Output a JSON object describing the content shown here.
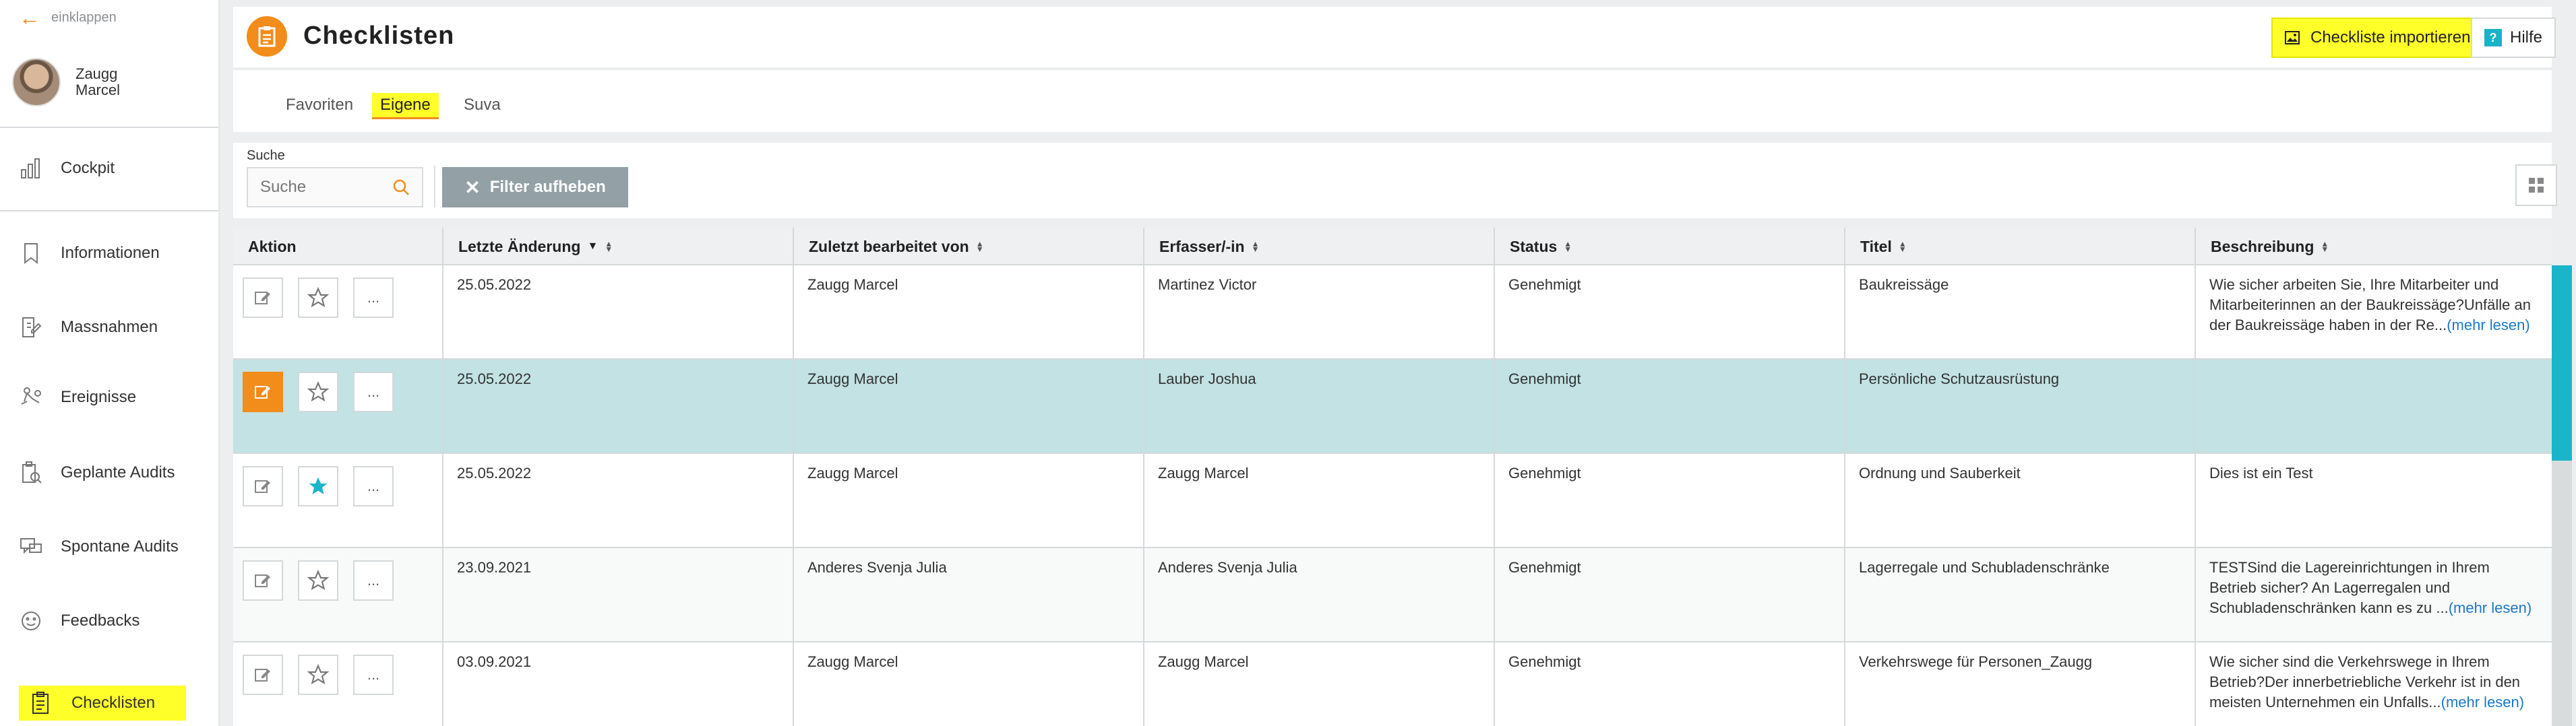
{
  "sidebar": {
    "collapse_label": "einklappen",
    "user": {
      "first": "Zaugg",
      "last": "Marcel"
    },
    "items": [
      {
        "label": "Cockpit",
        "icon": "chart-icon"
      },
      {
        "label": "Informationen",
        "icon": "bookmark-icon"
      },
      {
        "label": "Massnahmen",
        "icon": "edit-doc-icon"
      },
      {
        "label": "Ereignisse",
        "icon": "injury-icon"
      },
      {
        "label": "Geplante Audits",
        "icon": "clipboard-search-icon"
      },
      {
        "label": "Spontane Audits",
        "icon": "chat-icon"
      },
      {
        "label": "Feedbacks",
        "icon": "face-icon"
      },
      {
        "label": "Checklisten",
        "icon": "clipboard-icon"
      }
    ]
  },
  "header": {
    "title": "Checklisten",
    "import_label": "Checkliste importieren",
    "help_label": "Hilfe"
  },
  "tabs": [
    {
      "label": "Favoriten"
    },
    {
      "label": "Eigene",
      "active": true
    },
    {
      "label": "Suva"
    }
  ],
  "filters": {
    "search_label": "Suche",
    "search_placeholder": "Suche",
    "clear_label": "Filter aufheben"
  },
  "table": {
    "columns": [
      "Aktion",
      "Letzte Änderung",
      "Zuletzt bearbeitet von",
      "Erfasser/-in",
      "Status",
      "Titel",
      "Beschreibung"
    ],
    "sorted_column_marker": "▼",
    "more_label": "(mehr lesen)",
    "rows": [
      {
        "date": "25.05.2022",
        "editor": "Zaugg Marcel",
        "author": "Martinez Victor",
        "status": "Genehmigt",
        "title": "Baukreissäge",
        "desc": "Wie sicher arbeiten Sie, Ihre Mitarbeiter und Mitarbeiterinnen an der Baukreissäge?Unfälle an der Baukreissäge haben in der Re...",
        "more": true,
        "fav": false
      },
      {
        "date": "25.05.2022",
        "editor": "Zaugg Marcel",
        "author": "Lauber Joshua",
        "status": "Genehmigt",
        "title": "Persönliche Schutzausrüstung",
        "desc": "",
        "more": false,
        "fav": false
      },
      {
        "date": "25.05.2022",
        "editor": "Zaugg Marcel",
        "author": "Zaugg Marcel",
        "status": "Genehmigt",
        "title": "Ordnung und Sauberkeit",
        "desc": "Dies ist ein Test",
        "more": false,
        "fav": true
      },
      {
        "date": "23.09.2021",
        "editor": "Anderes Svenja Julia",
        "author": "Anderes Svenja Julia",
        "status": "Genehmigt",
        "title": "Lagerregale und Schubladenschränke",
        "desc": "TESTSind die Lagereinrichtungen in Ihrem Betrieb sicher? An Lagerregalen und Schubladenschränken kann es zu ...",
        "more": true,
        "fav": false
      },
      {
        "date": "03.09.2021",
        "editor": "Zaugg Marcel",
        "author": "Zaugg Marcel",
        "status": "Genehmigt",
        "title": "Verkehrswege für Personen_Zaugg",
        "desc": "Wie sicher sind die Verkehrswege in Ihrem Betrieb?Der innerbetriebliche Verkehr ist in den meisten Unternehmen ein Unfalls...",
        "more": true,
        "fav": false
      }
    ]
  },
  "colors": {
    "accent": "#f28c1b",
    "highlight": "#ffff2a",
    "teal": "#1ab5c9",
    "selected_row": "#c2e2e3"
  }
}
